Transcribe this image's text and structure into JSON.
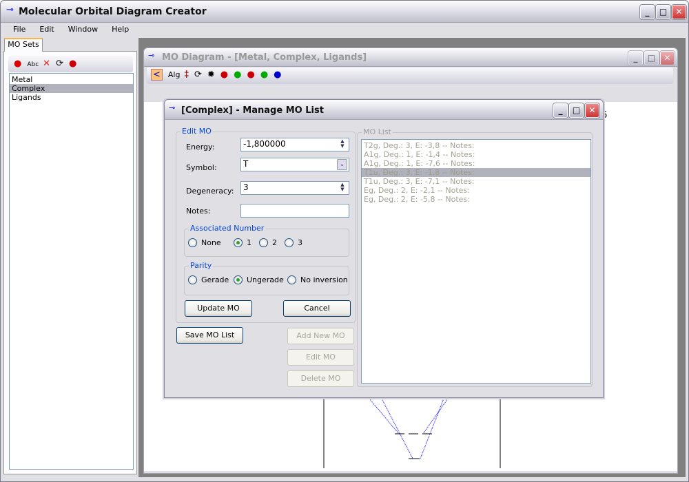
{
  "app": {
    "title": "Molecular Orbital Diagram Creator"
  },
  "menu": [
    "File",
    "Edit",
    "Window",
    "Help"
  ],
  "left_panel": {
    "tab": "MO Sets",
    "toolbar_text": "Abc",
    "items": [
      "Metal",
      "Complex",
      "Ligands"
    ],
    "selected": 1
  },
  "diagram_window": {
    "title": "MO Diagram - [Metal, Complex, Ligands]",
    "toolbar_text": "Alg",
    "partial_label": "6"
  },
  "dialog": {
    "title": "[Complex] - Manage MO List",
    "edit_group": "Edit MO",
    "energy_label": "Energy:",
    "energy_value": "-1,800000",
    "symbol_label": "Symbol:",
    "symbol_value": "T",
    "degeneracy_label": "Degeneracy:",
    "degeneracy_value": "3",
    "notes_label": "Notes:",
    "notes_value": "",
    "assoc_group": "Associated Number",
    "assoc_options": [
      "None",
      "1",
      "2",
      "3"
    ],
    "assoc_selected": 1,
    "parity_group": "Parity",
    "parity_options": [
      "Gerade",
      "Ungerade",
      "No inversion"
    ],
    "parity_selected": 1,
    "update_btn": "Update MO",
    "cancel_btn": "Cancel",
    "save_btn": "Save MO List",
    "add_btn": "Add New MO",
    "edit_btn": "Edit MO",
    "delete_btn": "Delete MO",
    "list_group": "MO List",
    "list_items": [
      "T2g, Deg.: 3, E: -3,8  -- Notes:",
      "A1g, Deg.: 1, E: -1,4  -- Notes:",
      "A1g, Deg.: 1, E: -7,6  -- Notes:",
      "T1u, Deg.: 3, E: -1,8  -- Notes:",
      "T1u, Deg.: 3, E: -7,1  -- Notes:",
      "Eg, Deg.: 2, E: -2,1  -- Notes:",
      "Eg, Deg.: 2, E: -5,8  -- Notes:"
    ],
    "list_selected": 3
  },
  "colors": {
    "accent": "#0046d5",
    "selection": "#b0b2bc",
    "mdi_bg": "#808080",
    "orbital_line": "#0000ff"
  }
}
